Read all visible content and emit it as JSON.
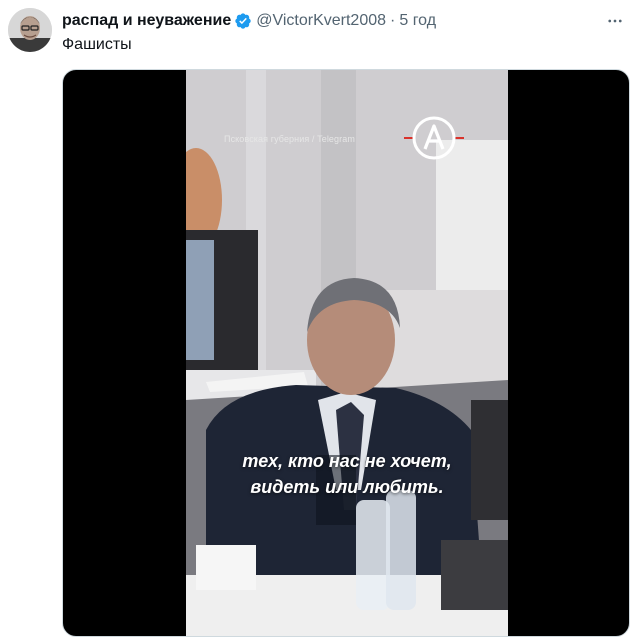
{
  "tweet": {
    "author": {
      "display_name": "распад и неуважение",
      "handle": "@VictorKvert2008",
      "verified": true,
      "avatar_icon": "avatar-photo"
    },
    "separator": "·",
    "time": "5 год",
    "text": "Фашисты",
    "more_icon": "more-horizontal-icon"
  },
  "media": {
    "watermark": "Псковская губерния / Telegram",
    "logo_icon": "letter-a-logo",
    "subtitle_lines": [
      "тех, кто нас не хочет,",
      "видеть или любить."
    ]
  },
  "colors": {
    "verified": "#1d9bf0",
    "secondary_text": "#536471",
    "media_background": "#000000"
  }
}
